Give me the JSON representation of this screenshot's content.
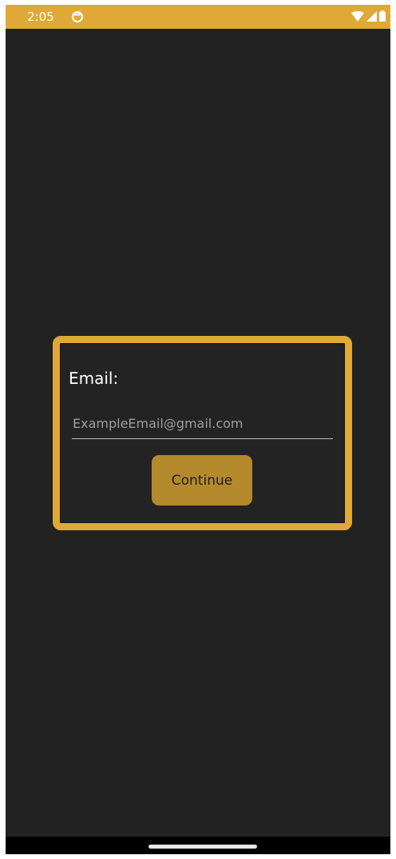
{
  "status_bar": {
    "time": "2:05",
    "app_icon": "circle-app-icon",
    "wifi_icon": "wifi-icon",
    "signal_icon": "signal-icon",
    "battery_icon": "battery-icon",
    "color": "#e0a836"
  },
  "login_card": {
    "email_label": "Email:",
    "email_placeholder": "ExampleEmail@gmail.com",
    "email_value": "",
    "continue_label": "Continue",
    "border_color": "#e0a836",
    "button_color": "#b48a2c"
  },
  "nav_bar": {
    "home_indicator": "home-indicator"
  },
  "colors": {
    "background": "#222222",
    "accent": "#e0a836"
  }
}
